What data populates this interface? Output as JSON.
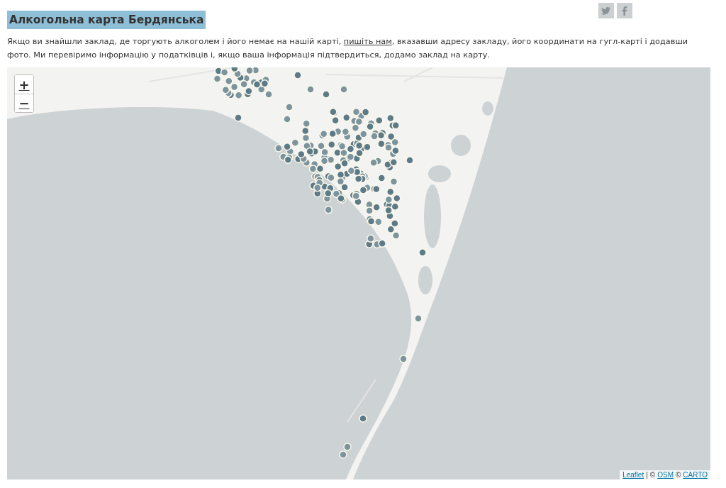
{
  "title": "Алкогольна карта Бердянська",
  "intro": {
    "before": "Якщо ви знайшли заклад, де торгують алкоголем і його немає на нашій карті, ",
    "link": "пишіть нам",
    "after": ", вказавши адресу закладу, його координати на гугл-карті і додавши фото. Ми перевіримо інформацію у податківців і, якщо ваша інформація підтвердиться, додамо заклад на карту."
  },
  "map": {
    "zoom_in": "+",
    "zoom_out": "−",
    "attribution": [
      {
        "kind": "link",
        "text": "Leaflet"
      },
      {
        "kind": "text",
        "text": "|"
      },
      {
        "kind": "text",
        "text": "©"
      },
      {
        "kind": "link",
        "text": "OSM"
      },
      {
        "kind": "text",
        "text": "©"
      },
      {
        "kind": "link",
        "text": "CARTO"
      }
    ]
  }
}
